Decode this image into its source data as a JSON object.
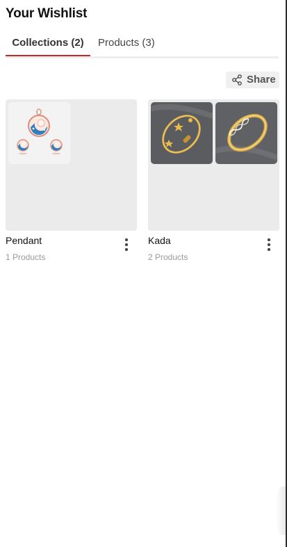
{
  "page": {
    "title": "Your Wishlist"
  },
  "tabs": [
    {
      "label": "Collections (2)",
      "active": true
    },
    {
      "label": "Products (3)",
      "active": false
    }
  ],
  "share": {
    "label": "Share",
    "icon": "share-icon"
  },
  "collections": [
    {
      "name": "Pendant",
      "count": "1 Products",
      "thumbnails": [
        "pendant-set-image"
      ]
    },
    {
      "name": "Kada",
      "count": "2 Products",
      "thumbnails": [
        "gold-kada-star-image",
        "gold-kada-infinity-image"
      ]
    }
  ],
  "colors": {
    "accent": "#c0272d",
    "card_bg": "#ebebeb",
    "thumb_dark": "#5a5c5f"
  }
}
